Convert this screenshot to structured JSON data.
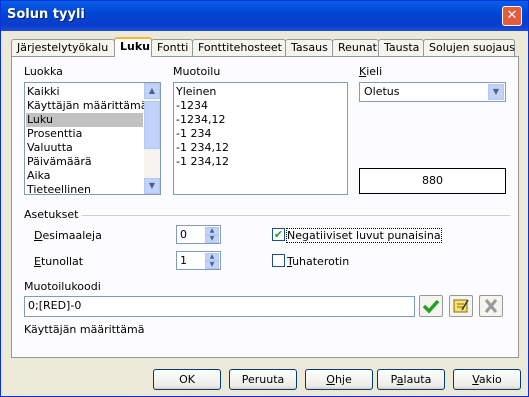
{
  "window": {
    "title": "Solun tyyli",
    "close_glyph": "✕"
  },
  "tabs": [
    {
      "label": "Järjestelytyökalu"
    },
    {
      "label": "Luku"
    },
    {
      "label": "Fontti"
    },
    {
      "label": "Fonttitehosteet"
    },
    {
      "label": "Tasaus"
    },
    {
      "label": "Reunat"
    },
    {
      "label": "Tausta"
    },
    {
      "label": "Solujen suojaus"
    }
  ],
  "category": {
    "label": "Luokka",
    "items": [
      "Kaikki",
      "Käyttäjän määrittämä",
      "Luku",
      "Prosenttia",
      "Valuutta",
      "Päivämäärä",
      "Aika",
      "Tieteellinen"
    ],
    "selected": "Luku"
  },
  "format": {
    "label": "Muotoilu",
    "items": [
      "Yleinen",
      "-1234",
      "-1234,12",
      "-1 234",
      "-1 234,12",
      "-1 234,12"
    ]
  },
  "language": {
    "label": "Kieli",
    "value": "Oletus"
  },
  "preview": {
    "value": "880"
  },
  "options": {
    "label": "Asetukset",
    "decimals_label": "Desimaaleja",
    "decimals_value": "0",
    "leading_zeros_label": "Etunollat",
    "leading_zeros_value": "1",
    "negative_red_label": "Negatiiviset luvut punaisina",
    "negative_red_checked": true,
    "thousands_sep_label": "Tuhaterotin",
    "thousands_sep_checked": false
  },
  "format_code": {
    "label": "Muotoilukoodi",
    "value": "0;[RED]-0",
    "description": "Käyttäjän määrittämä"
  },
  "buttons": {
    "ok": "OK",
    "cancel": "Peruuta",
    "help": "Ohje",
    "reset": "Palauta",
    "default": "Vakio"
  },
  "colors": {
    "titlebar": "#0046d5",
    "selected_item": "#c1c1c1",
    "check_green": "#21a121"
  }
}
